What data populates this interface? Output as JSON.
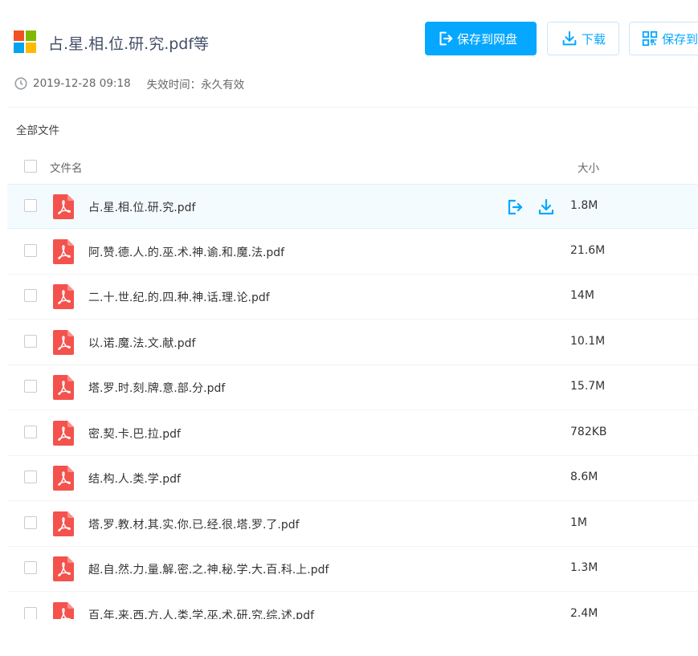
{
  "header": {
    "title": "占.星.相.位.研.究.pdf等",
    "buttons": {
      "save_to_disk": "保存到网盘",
      "download": "下载",
      "save_qr": "保存到手机"
    },
    "date": "2019-12-28 09:18",
    "expiry": "失效时间：永久有效"
  },
  "breadcrumb": "全部文件",
  "table": {
    "col_name": "文件名",
    "col_size": "大小",
    "rows": [
      {
        "name": "占.星.相.位.研.究.pdf",
        "size": "1.8M"
      },
      {
        "name": "阿.赞.德.人.的.巫.术.神.谕.和.魔.法.pdf",
        "size": "21.6M"
      },
      {
        "name": "二.十.世.纪.的.四.种.神.话.理.论.pdf",
        "size": "14M"
      },
      {
        "name": "以.诺.魔.法.文.献.pdf",
        "size": "10.1M"
      },
      {
        "name": "塔.罗.时.刻.牌.意.部.分.pdf",
        "size": "15.7M"
      },
      {
        "name": "密.契.卡.巴.拉.pdf",
        "size": "782KB"
      },
      {
        "name": "结.构.人.类.学.pdf",
        "size": "8.6M"
      },
      {
        "name": "塔.罗.教.材.其.实.你.已.经.很.塔.罗.了.pdf",
        "size": "1M"
      },
      {
        "name": "超.自.然.力.量.解.密.之.神.秘.学.大.百.科.上.pdf",
        "size": "1.3M"
      },
      {
        "name": "百.年.来.西.方.人.类.学.巫.术.研.究.综.述.pdf",
        "size": "2.4M"
      }
    ]
  },
  "icons": {
    "logo": "windows-logo-icon",
    "clock": "clock-icon",
    "file": "pdf-file-icon",
    "save": "save-to-disk-icon",
    "download": "download-icon",
    "qr": "qr-code-icon"
  },
  "colors": {
    "accent": "#06a7ff",
    "pdf": "#f4524d",
    "highlight_row": "#f4fbff",
    "logo": [
      "#f25022",
      "#7fba00",
      "#00a4ef",
      "#ffb900"
    ]
  }
}
